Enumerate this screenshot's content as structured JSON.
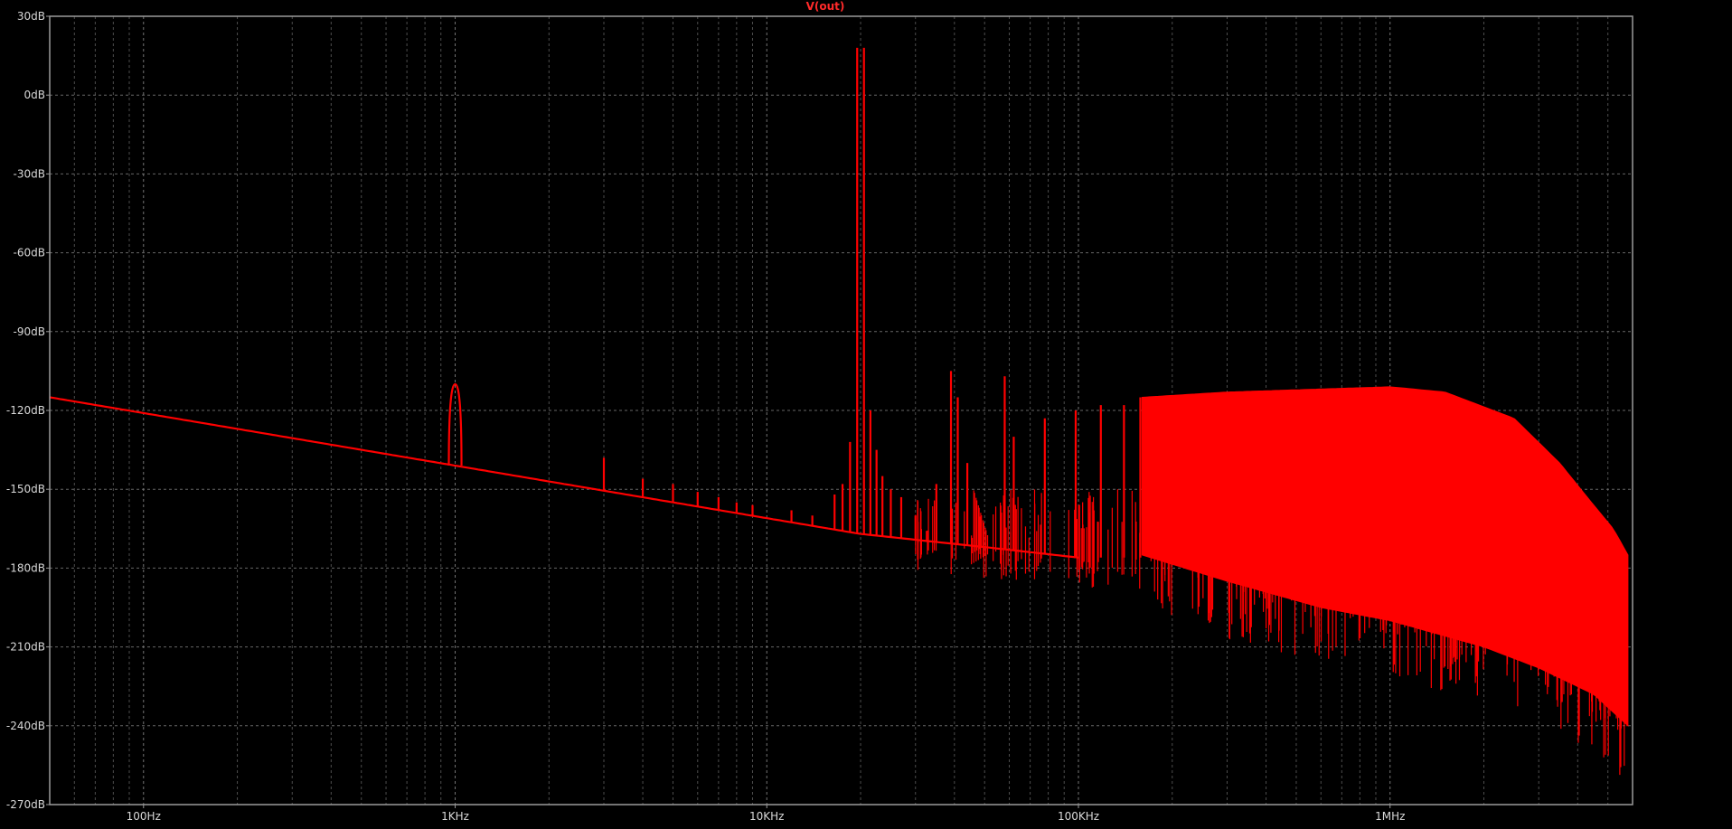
{
  "chart_data": {
    "type": "line",
    "title": "V(out)",
    "x_scale": "log",
    "xlim": [
      50,
      6000000
    ],
    "ylim": [
      -270,
      30
    ],
    "grid": true,
    "background_color": "#000000",
    "grid_color": "#808080",
    "series_color": "#ff0000",
    "x_ticks": [
      {
        "value": 100,
        "label": "100Hz"
      },
      {
        "value": 1000,
        "label": "1KHz"
      },
      {
        "value": 10000,
        "label": "10KHz"
      },
      {
        "value": 100000,
        "label": "100KHz"
      },
      {
        "value": 1000000,
        "label": "1MHz"
      }
    ],
    "y_ticks": [
      {
        "value": 30,
        "label": "30dB"
      },
      {
        "value": 0,
        "label": "0dB"
      },
      {
        "value": -30,
        "label": "-30dB"
      },
      {
        "value": -60,
        "label": "-60dB"
      },
      {
        "value": -90,
        "label": "-90dB"
      },
      {
        "value": -120,
        "label": "-120dB"
      },
      {
        "value": -150,
        "label": "-150dB"
      },
      {
        "value": -180,
        "label": "-180dB"
      },
      {
        "value": -210,
        "label": "-210dB"
      },
      {
        "value": -240,
        "label": "-240dB"
      },
      {
        "value": -270,
        "label": "-270dB"
      }
    ],
    "series": [
      {
        "noise_floor": [
          [
            50,
            -115
          ],
          [
            100,
            -121
          ],
          [
            1000,
            -141
          ],
          [
            10000,
            -161
          ],
          [
            20000,
            -167
          ],
          [
            50000,
            -172
          ],
          [
            100000,
            -176
          ]
        ],
        "peaks": [
          {
            "x": 1000,
            "y": -110
          },
          {
            "x": 3000,
            "y": -138
          },
          {
            "x": 4000,
            "y": -146
          },
          {
            "x": 5000,
            "y": -148
          },
          {
            "x": 6000,
            "y": -151
          },
          {
            "x": 7000,
            "y": -153
          },
          {
            "x": 8000,
            "y": -155
          },
          {
            "x": 9000,
            "y": -156
          },
          {
            "x": 12000,
            "y": -158
          },
          {
            "x": 14000,
            "y": -160
          },
          {
            "x": 16500,
            "y": -152
          },
          {
            "x": 17500,
            "y": -148
          },
          {
            "x": 18500,
            "y": -132
          },
          {
            "x": 19500,
            "y": 18
          },
          {
            "x": 20500,
            "y": 18
          },
          {
            "x": 21500,
            "y": -120
          },
          {
            "x": 22500,
            "y": -135
          },
          {
            "x": 23500,
            "y": -145
          },
          {
            "x": 25000,
            "y": -150
          },
          {
            "x": 27000,
            "y": -153
          },
          {
            "x": 30000,
            "y": -160
          },
          {
            "x": 35000,
            "y": -148
          },
          {
            "x": 39000,
            "y": -105
          },
          {
            "x": 41000,
            "y": -115
          },
          {
            "x": 44000,
            "y": -140
          },
          {
            "x": 58000,
            "y": -107
          },
          {
            "x": 62000,
            "y": -130
          },
          {
            "x": 78000,
            "y": -123
          },
          {
            "x": 98000,
            "y": -120
          },
          {
            "x": 118000,
            "y": -118
          },
          {
            "x": 140000,
            "y": -118
          },
          {
            "x": 158000,
            "y": -115
          }
        ],
        "band_upper": [
          [
            160000,
            -115
          ],
          [
            300000,
            -113
          ],
          [
            1000000,
            -111
          ],
          [
            1500000,
            -113
          ],
          [
            2500000,
            -123
          ],
          [
            3500000,
            -140
          ],
          [
            4500000,
            -156
          ],
          [
            5200000,
            -165
          ],
          [
            5800000,
            -175
          ]
        ],
        "band_lower": [
          [
            160000,
            -175
          ],
          [
            300000,
            -185
          ],
          [
            600000,
            -195
          ],
          [
            1000000,
            -200
          ],
          [
            2000000,
            -210
          ],
          [
            3000000,
            -218
          ],
          [
            4500000,
            -228
          ],
          [
            5800000,
            -240
          ]
        ]
      }
    ]
  }
}
